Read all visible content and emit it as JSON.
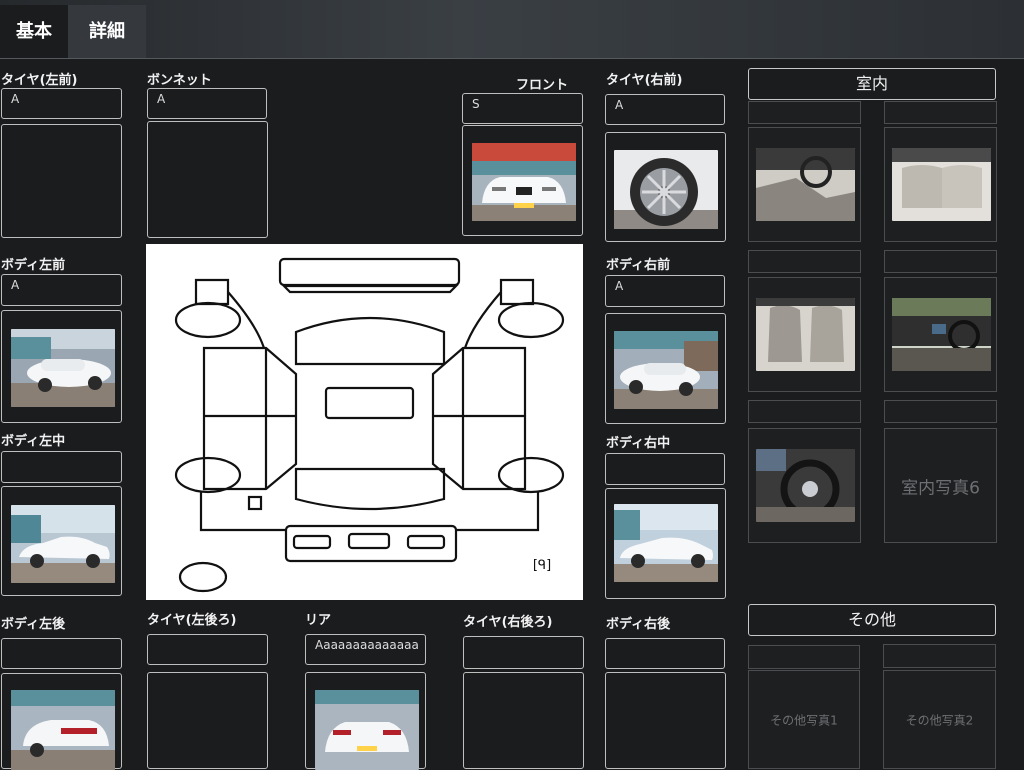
{
  "tabs": {
    "basic": "基本",
    "detail": "詳細"
  },
  "left": {
    "tire_front_left": {
      "label": "タイヤ(左前)",
      "value": "A"
    },
    "body_left_front": {
      "label": "ボディ左前",
      "value": "A"
    },
    "body_left_middle": {
      "label": "ボディ左中",
      "value": ""
    },
    "body_left_rear": {
      "label": "ボディ左後",
      "value": ""
    }
  },
  "center": {
    "bonnet": {
      "label": "ボンネット",
      "value": "A"
    },
    "front": {
      "label": "フロント",
      "value": "S"
    },
    "tire_rear_left": {
      "label": "タイヤ(左後ろ)",
      "value": ""
    },
    "rear": {
      "label": "リア",
      "value": "Aaaaaaaaaaaaaa"
    },
    "tire_rear_right": {
      "label": "タイヤ(右後ろ)",
      "value": ""
    },
    "zoom_icon": "zoom-icon"
  },
  "right": {
    "tire_front_right": {
      "label": "タイヤ(右前)",
      "value": "A"
    },
    "body_right_front": {
      "label": "ボディ右前",
      "value": "A"
    },
    "body_right_middle": {
      "label": "ボディ右中",
      "value": ""
    },
    "body_right_rear": {
      "label": "ボディ右後",
      "value": ""
    }
  },
  "interior": {
    "title": "室内",
    "photo6_placeholder": "室内写真6"
  },
  "other": {
    "title": "その他",
    "photo1_placeholder": "その他写真1",
    "photo2_placeholder": "その他写真2"
  },
  "colors": {
    "background": "#1b1c1e",
    "border": "#bfbfbf",
    "car_white": "#f3f4f6"
  }
}
